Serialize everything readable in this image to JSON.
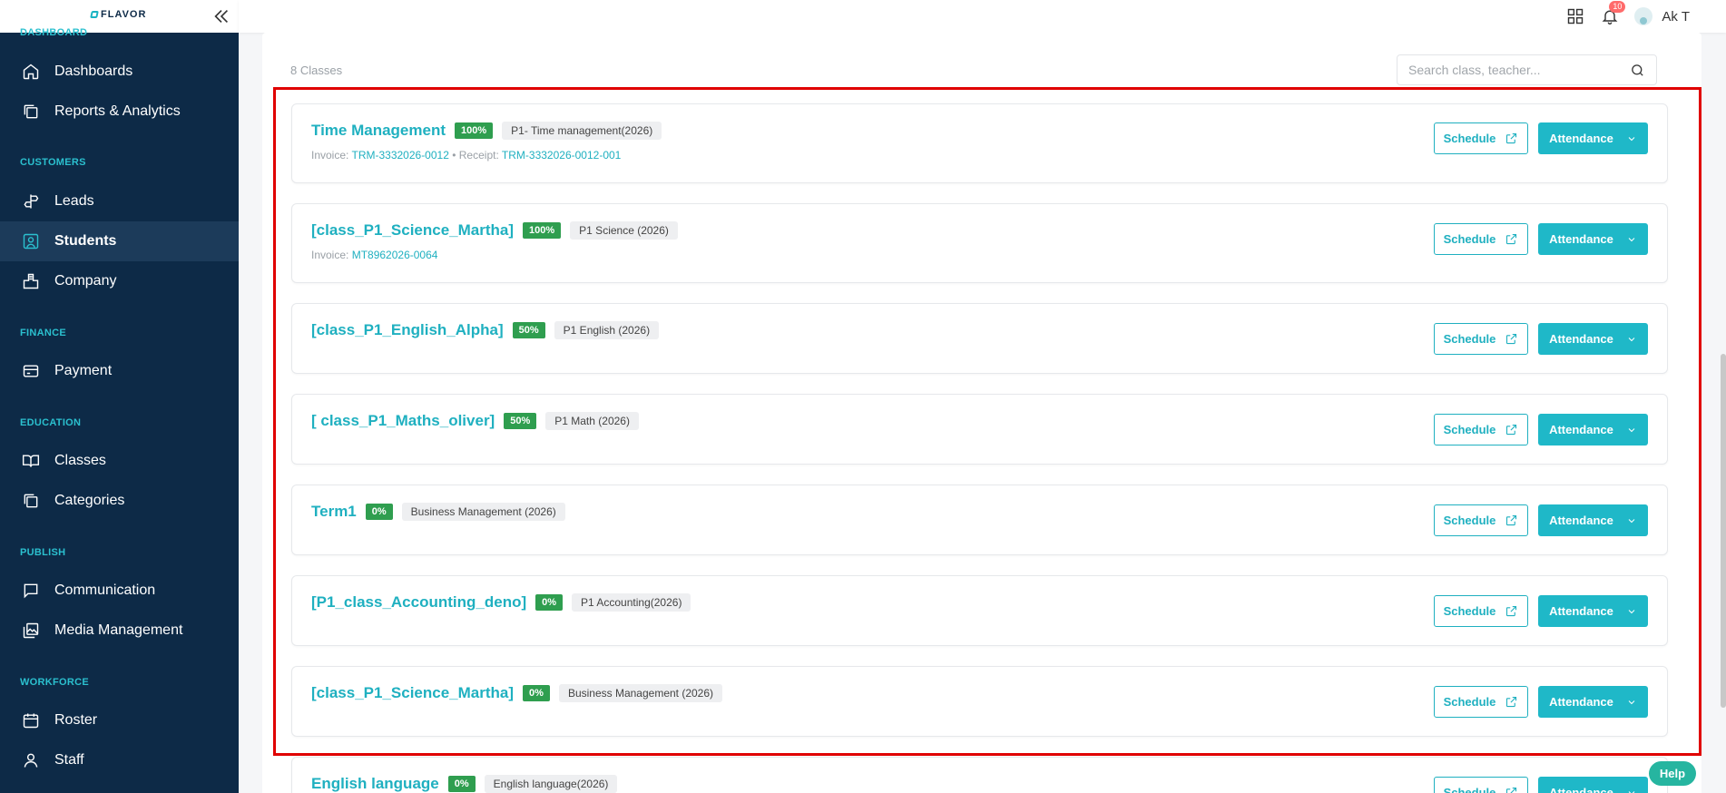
{
  "brand": {
    "name": "FLAVOR"
  },
  "sidebar": {
    "sections": [
      {
        "label": "DASHBOARD"
      },
      {
        "label": "CUSTOMERS"
      },
      {
        "label": "FINANCE"
      },
      {
        "label": "EDUCATION"
      },
      {
        "label": "PUBLISH"
      },
      {
        "label": "WORKFORCE"
      }
    ],
    "items": [
      {
        "label": "Dashboards",
        "icon": "home-icon"
      },
      {
        "label": "Reports & Analytics",
        "icon": "copy-icon"
      },
      {
        "label": "Leads",
        "icon": "signpost-icon"
      },
      {
        "label": "Students",
        "icon": "user-square-icon",
        "active": true
      },
      {
        "label": "Company",
        "icon": "building-icon"
      },
      {
        "label": "Payment",
        "icon": "card-icon"
      },
      {
        "label": "Classes",
        "icon": "book-icon"
      },
      {
        "label": "Categories",
        "icon": "copy-icon"
      },
      {
        "label": "Communication",
        "icon": "message-square-icon"
      },
      {
        "label": "Media Management",
        "icon": "images-icon"
      },
      {
        "label": "Roster",
        "icon": "calendar-icon"
      },
      {
        "label": "Staff",
        "icon": "user-icon"
      }
    ]
  },
  "header": {
    "notification_count": "10",
    "user_name": "Ak T"
  },
  "main": {
    "class_count": "8 Classes",
    "search_placeholder": "Search class, teacher..."
  },
  "classes": [
    {
      "title": "Time Management",
      "progress": "100%",
      "course": "P1- Time management(2026)",
      "invoice_label": "Invoice:",
      "invoice": "TRM-3332026-0012",
      "receipt_label": "• Receipt:",
      "receipt": "TRM-3332026-0012-001",
      "schedule_label": "Schedule",
      "attendance_label": "Attendance"
    },
    {
      "title": "[class_P1_Science_Martha]",
      "progress": "100%",
      "course": "P1 Science (2026)",
      "invoice_label": "Invoice:",
      "invoice": "MT8962026-0064",
      "schedule_label": "Schedule",
      "attendance_label": "Attendance"
    },
    {
      "title": "[class_P1_English_Alpha]",
      "progress": "50%",
      "course": "P1 English (2026)",
      "schedule_label": "Schedule",
      "attendance_label": "Attendance"
    },
    {
      "title": "[ class_P1_Maths_oliver]",
      "progress": "50%",
      "course": "P1 Math (2026)",
      "schedule_label": "Schedule",
      "attendance_label": "Attendance"
    },
    {
      "title": "Term1",
      "progress": "0%",
      "course": "Business Management (2026)",
      "schedule_label": "Schedule",
      "attendance_label": "Attendance"
    },
    {
      "title": "[P1_class_Accounting_deno]",
      "progress": "0%",
      "course": "P1 Accounting(2026)",
      "schedule_label": "Schedule",
      "attendance_label": "Attendance"
    },
    {
      "title": "[class_P1_Science_Martha]",
      "progress": "0%",
      "course": "Business Management (2026)",
      "schedule_label": "Schedule",
      "attendance_label": "Attendance"
    },
    {
      "title": "English language",
      "progress": "0%",
      "course": "English language(2026)",
      "schedule_label": "Schedule",
      "attendance_label": "Attendance"
    }
  ],
  "help": {
    "label": "Help"
  },
  "colors": {
    "sidebar_bg": "#0d2a47",
    "accent": "#1fb0c0",
    "progress_green": "#2f9e4f",
    "highlight_red": "#e00000"
  }
}
